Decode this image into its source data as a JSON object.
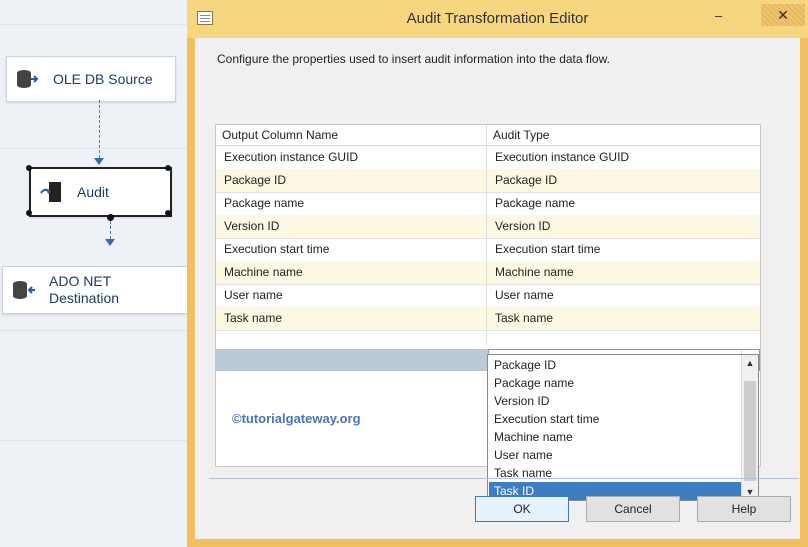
{
  "designer": {
    "components": [
      {
        "label": "OLE DB Source",
        "icon": "database-source-icon"
      },
      {
        "label": "Audit",
        "icon": "audit-transform-icon"
      },
      {
        "label_line1": "ADO NET",
        "label_line2": "Destination",
        "icon": "database-destination-icon"
      }
    ]
  },
  "dialog": {
    "title": "Audit Transformation Editor",
    "minimize": "‒",
    "close": "✕",
    "description": "Configure the properties used to insert audit information into the data flow."
  },
  "grid": {
    "columns": [
      "Output Column Name",
      "Audit Type"
    ],
    "rows": [
      [
        "Execution instance GUID",
        "Execution instance GUID"
      ],
      [
        "Package ID",
        "Package ID"
      ],
      [
        "Package name",
        "Package name"
      ],
      [
        "Version ID",
        "Version ID"
      ],
      [
        "Execution start time",
        "Execution start time"
      ],
      [
        "Machine name",
        "Machine name"
      ],
      [
        "User name",
        "User name"
      ],
      [
        "Task name",
        "Task name"
      ]
    ],
    "new_row_audit_value": ""
  },
  "watermark": "©tutorialgateway.org",
  "dropdown": {
    "items": [
      "Package ID",
      "Package name",
      "Version ID",
      "Execution start time",
      "Machine name",
      "User name",
      "Task name",
      "Task ID"
    ],
    "selected": "Task ID"
  },
  "buttons": {
    "ok": "OK",
    "cancel": "Cancel",
    "help": "Help"
  },
  "colors": {
    "accent": "#3c7dc4",
    "title_bar": "#f7d680",
    "alt_row": "#fdf8e1"
  }
}
